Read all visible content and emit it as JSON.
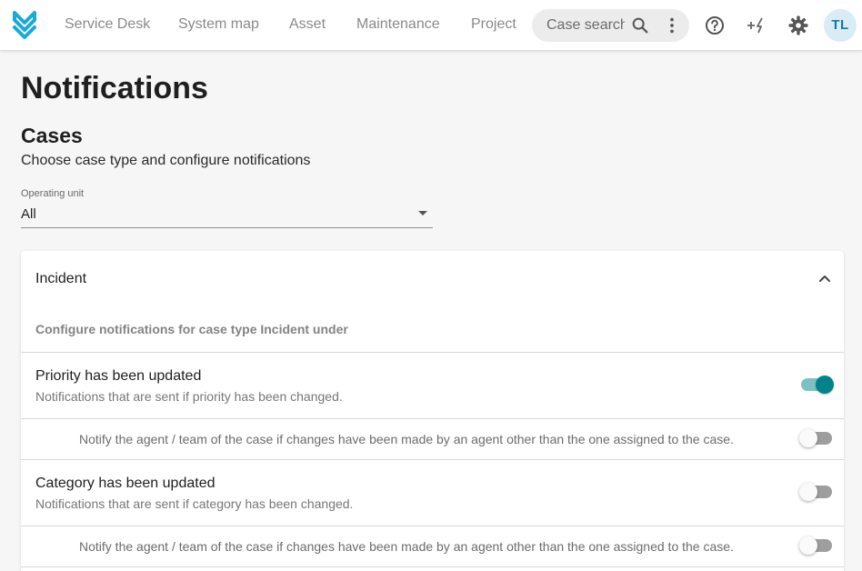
{
  "app": {
    "user_initials": "TL",
    "brand_color": "#1aa9d8",
    "accent_color": "#00838a"
  },
  "nav": {
    "items": [
      {
        "label": "Service Desk"
      },
      {
        "label": "System map"
      },
      {
        "label": "Asset"
      },
      {
        "label": "Maintenance"
      },
      {
        "label": "Project"
      }
    ],
    "search": {
      "text": "Case search"
    },
    "icons": [
      "search-icon",
      "more-vert-icon",
      "help-icon",
      "quick-action-icon",
      "settings-icon"
    ]
  },
  "page": {
    "title": "Notifications"
  },
  "cases": {
    "title": "Cases",
    "subtitle": "Choose case type and configure notifications",
    "operating_unit": {
      "label": "Operating unit",
      "value": "All"
    }
  },
  "incident": {
    "title": "Incident",
    "expanded": true,
    "description": "Configure notifications for case type Incident under",
    "rows": [
      {
        "title": "Priority has been updated",
        "description": "Notifications that are sent if priority has been changed.",
        "enabled": true,
        "sub": {
          "text": "Notify the agent / team of the case if changes have been made by an agent other than the one assigned to the case.",
          "enabled": false
        }
      },
      {
        "title": "Category has been updated",
        "description": "Notifications that are sent if category has been changed.",
        "enabled": false,
        "sub": {
          "text": "Notify the agent / team of the case if changes have been made by an agent other than the one assigned to the case.",
          "enabled": false
        }
      }
    ]
  }
}
